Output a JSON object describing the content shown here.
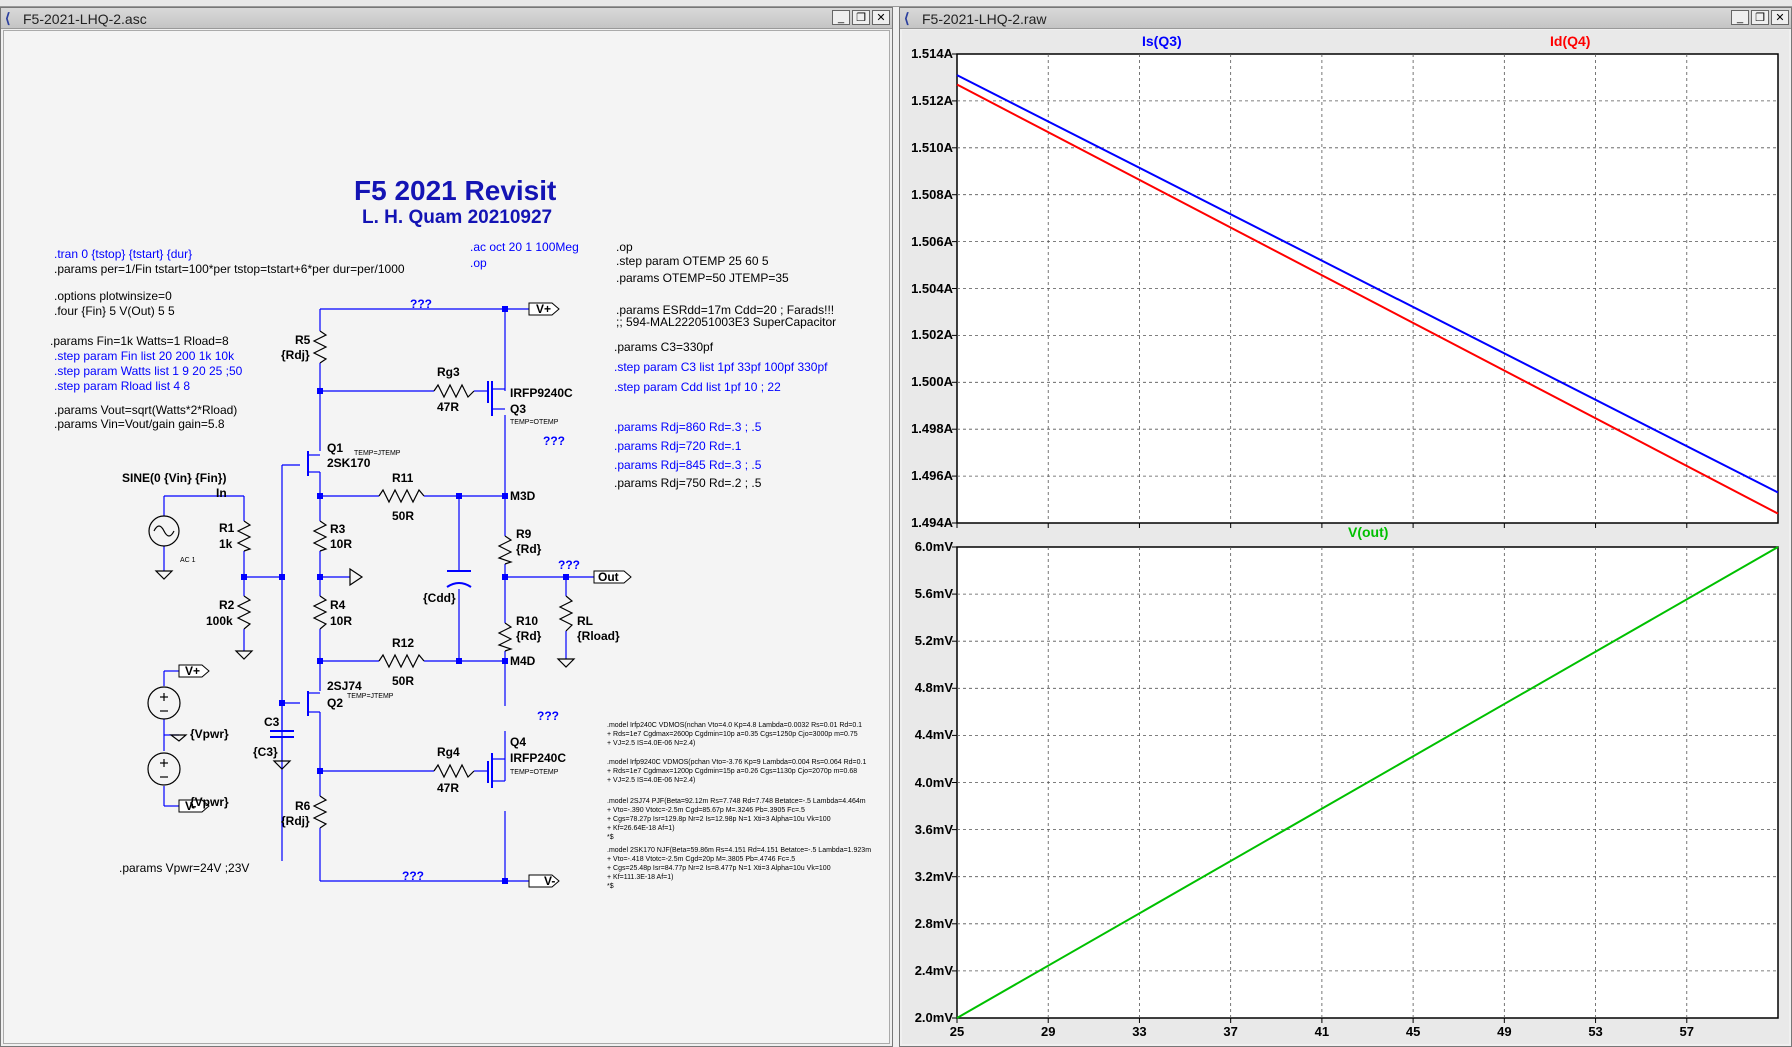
{
  "schematic_window": {
    "title": "F5-2021-LHQ-2.asc",
    "heading": "F5 2021 Revisit",
    "subheading": "L. H. Quam  20210927",
    "directives": {
      "tran": ".tran 0 {tstop} {tstart} {dur}",
      "params_per": ".params per=1/Fin tstart=100*per tstop=tstart+6*per dur=per/1000",
      "options": ".options plotwinsize=0",
      "four": ".four {Fin} 5 V(Out) 5 5",
      "params_fin": ".params Fin=1k Watts=1 Rload=8",
      "step_fin": ".step param Fin list 20 200 1k 10k",
      "step_watts": ".step param Watts list 1 9 20 25 ;50",
      "step_rload": ".step param Rload list 4 8",
      "params_vout": ".params Vout=sqrt(Watts*2*Rload)",
      "params_vin": ".params Vin=Vout/gain  gain=5.8",
      "ac": ".ac oct 20 1 100Meg",
      "op_blue": ".op",
      "op": ".op",
      "step_otemp": ".step param OTEMP 25 60 5",
      "params_otemp": ".params OTEMP=50 JTEMP=35",
      "params_esr": ".params ESRdd=17m Cdd=20 ; Farads!!!",
      "comment_cap": ";; 594-MAL222051003E3 SuperCapacitor",
      "params_c3": ".params C3=330pf",
      "step_c3": ".step param C3 list 1pf 33pf 100pf 330pf",
      "step_cdd": ".step param Cdd list 1pf 10 ; 22",
      "rdj1": ".params Rdj=860 Rd=.3 ; .5",
      "rdj2": ".params Rdj=720 Rd=.1",
      "rdj3": ".params Rdj=845 Rd=.3 ; .5",
      "rdj4": ".params Rdj=750 Rd=.2 ; .5",
      "vpwr": ".params Vpwr=24V ;23V"
    },
    "models": [
      ".model Irfp240C VDMOS(nchan Vto=4.0 Kp=4.8 Lambda=0.0032 Rs=0.01 Rd=0.1",
      "+ Rds=1e7 Cgdmax=2600p Cgdmin=10p a=0.35 Cgs=1250p Cjo=3000p m=0.75",
      "+ VJ=2.5 IS=4.0E-06 N=2.4)",
      ".model Irfp9240C VDMOS(pchan Vto=-3.76 Kp=9 Lambda=0.004 Rs=0.064 Rd=0.1",
      "+ Rds=1e7 Cgdmax=1200p Cgdmin=15p a=0.26 Cgs=1130p Cjo=2070p m=0.68",
      "+ VJ=2.5 IS=4.0E-06 N=2.4)",
      ".model 2SJ74   PJF(Beta=92.12m Rs=7.748 Rd=7.748 Betatce=-.5 Lambda=4.464m",
      "+           Vto=-.390 Vtotc=-2.5m Cgd=85.67p M=.3246 Pb=.3905 Fc=.5",
      "+           Cgs=78.27p Isr=129.8p Nr=2 Is=12.98p N=1 Xti=3 Alpha=10u Vk=100",
      "+           Kf=26.64E-18 Af=1)",
      "*$",
      ".model 2SK170  NJF(Beta=59.86m Rs=4.151 Rd=4.151 Betatce=-.5 Lambda=1.923m",
      "+           Vto=-.418 Vtotc=-2.5m Cgd=20p M=.3805 Pb=.4746 Fc=.5",
      "+           Cgs=25.48p Isr=84.77p Nr=2 Is=8.477p N=1 Xti=3 Alpha=10u Vk=100",
      "+           Kf=111.3E-18 Af=1)",
      "*$"
    ],
    "components": {
      "r5": "R5",
      "r5v": "{Rdj}",
      "rg3": "Rg3",
      "rg3v": "47R",
      "q3": "Q3",
      "q3m": "IRFP9240C",
      "q3t": "TEMP=OTEMP",
      "q1": "Q1",
      "q1m": "2SK170",
      "q1t": "TEMP=JTEMP",
      "r11": "R11",
      "r11v": "50R",
      "r3": "R3",
      "r3v": "10R",
      "r4": "R4",
      "r4v": "10R",
      "r12": "R12",
      "r12v": "50R",
      "q2": "Q2",
      "q2m": "2SJ74",
      "q2t": "TEMP=JTEMP",
      "rg4": "Rg4",
      "rg4v": "47R",
      "q4": "Q4",
      "q4m": "IRFP240C",
      "q4t": "TEMP=OTEMP",
      "r6": "R6",
      "r6v": "{Rdj}",
      "r9": "R9",
      "r9v": "{Rd}",
      "r10": "R10",
      "r10v": "{Rd}",
      "rl": "RL",
      "rlv": "{Rload}",
      "cdd": "{Cdd}",
      "c3": "C3",
      "c3v": "{C3}",
      "r1": "R1",
      "r1v": "1k",
      "r2": "R2",
      "r2v": "100k",
      "sine": "SINE(0 {Vin} {Fin})",
      "ac1": "AC 1",
      "vpwr1": "{Vpwr}",
      "vpwr2": "{Vpwr}",
      "in": "In",
      "m3d": "M3D",
      "m4d": "M4D",
      "vplus": "V+",
      "vminus": "V-",
      "vplus2": "V+",
      "vminus2": "V-",
      "out": "Out",
      "q1_top": "???",
      "q2_bot": "???",
      "q3_mid": "???",
      "q_out": "???",
      "q4_mid": "???"
    }
  },
  "waveform_window": {
    "title": "F5-2021-LHQ-2.raw",
    "trace_is": "Is(Q3)",
    "trace_id": "Id(Q4)",
    "trace_vout": "V(out)",
    "colors": {
      "is": "#0000ff",
      "id": "#ff0000",
      "vout": "#00c000"
    }
  },
  "chart_data": [
    {
      "type": "line",
      "x": [
        25,
        61
      ],
      "x_ticks": [
        "25",
        "29",
        "33",
        "37",
        "41",
        "45",
        "49",
        "53",
        "57"
      ],
      "y_ticks": [
        "1.514A",
        "1.512A",
        "1.510A",
        "1.508A",
        "1.506A",
        "1.504A",
        "1.502A",
        "1.500A",
        "1.498A",
        "1.496A",
        "1.494A"
      ],
      "ylim": [
        1.494,
        1.514
      ],
      "grid": true,
      "series": [
        {
          "name": "Is(Q3)",
          "x": [
            25,
            61
          ],
          "values": [
            1.5131,
            1.4953
          ]
        },
        {
          "name": "Id(Q4)",
          "x": [
            25,
            61
          ],
          "values": [
            1.5127,
            1.4944
          ]
        }
      ]
    },
    {
      "type": "line",
      "x": [
        25,
        61
      ],
      "x_ticks": [
        "25",
        "29",
        "33",
        "37",
        "41",
        "45",
        "49",
        "53",
        "57"
      ],
      "y_ticks": [
        "6.0mV",
        "5.6mV",
        "5.2mV",
        "4.8mV",
        "4.4mV",
        "4.0mV",
        "3.6mV",
        "3.2mV",
        "2.8mV",
        "2.4mV",
        "2.0mV"
      ],
      "ylim": [
        2.0,
        6.0
      ],
      "grid": true,
      "series": [
        {
          "name": "V(out)",
          "x": [
            25,
            61
          ],
          "values": [
            2.0,
            6.0
          ]
        }
      ]
    }
  ]
}
